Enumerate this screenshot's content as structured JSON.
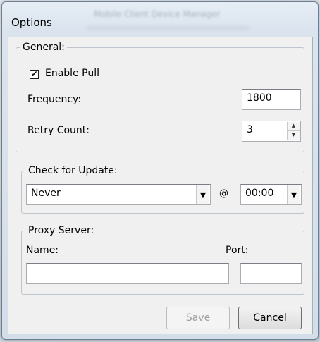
{
  "window": {
    "title": "Options",
    "background_title": "Mobile Client Device Manager"
  },
  "general": {
    "legend": "General:",
    "enable_pull": {
      "label": "Enable Pull",
      "checked": true,
      "check_mark": "✔"
    },
    "frequency": {
      "label": "Frequency:",
      "value": "1800"
    },
    "retry_count": {
      "label": "Retry Count:",
      "value": "3"
    }
  },
  "update": {
    "legend": "Check for Update:",
    "schedule": {
      "selected": "Never"
    },
    "at_symbol": "@",
    "time": {
      "selected": "00:00"
    }
  },
  "proxy": {
    "legend": "Proxy Server:",
    "name_label": "Name:",
    "name_value": "",
    "port_label": "Port:",
    "port_value": ""
  },
  "buttons": {
    "save": "Save",
    "cancel": "Cancel"
  },
  "icons": {
    "dropdown_arrow": "▼",
    "spin_up": "▲",
    "spin_down": "▼"
  },
  "colors": {
    "disabled_text": "#a0a0a0",
    "group_border": "#bfc5cc"
  }
}
